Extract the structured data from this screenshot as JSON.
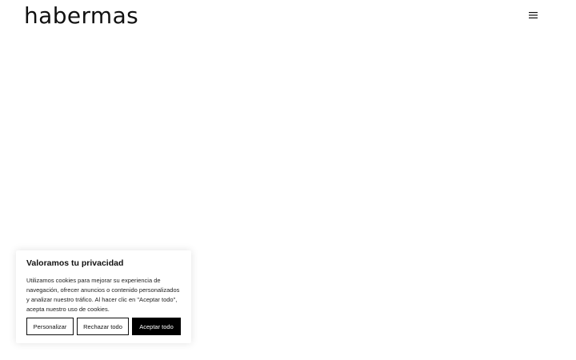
{
  "header": {
    "logo_text": "habermas",
    "menu_icon": "hamburger-menu-icon"
  },
  "cookie_banner": {
    "title": "Valoramos tu privacidad",
    "body": "Utilizamos cookies para mejorar su experiencia de navegación, ofrecer anuncios o contenido personalizados y analizar nuestro tráfico. Al hacer clic en \"Aceptar todo\", acepta nuestro uso de cookies.",
    "buttons": {
      "customize": "Personalizar",
      "reject": "Rechazar todo",
      "accept": "Aceptar todo"
    }
  },
  "colors": {
    "background": "#ffffff",
    "text": "#111111",
    "accept_button_bg": "#000000",
    "accept_button_text": "#ffffff"
  }
}
